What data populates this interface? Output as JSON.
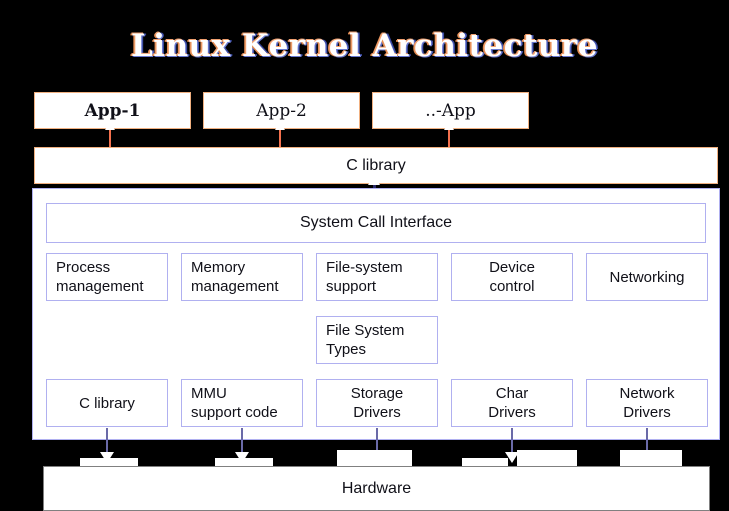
{
  "title": "Linux Kernel Architecture",
  "apps": [
    {
      "label": "App-1",
      "bold": true
    },
    {
      "label": "App-2",
      "bold": false
    },
    {
      "label": "..-App",
      "bold": false
    }
  ],
  "c_library_top": "C library",
  "kernel": {
    "system_call_interface": "System Call Interface",
    "subsystems": [
      "Process\nmanagement",
      "Memory\nmanagement",
      "File-system\nsupport",
      "Device\ncontrol",
      "Networking"
    ],
    "file_system_types": "File System\nTypes",
    "implementations": [
      "C library",
      "MMU\nsupport code",
      "Storage\nDrivers",
      "Char\nDrivers",
      "Network\nDrivers"
    ]
  },
  "hardware": "Hardware",
  "colors": {
    "background": "#000000",
    "app_border": "#f0b080",
    "kernel_border": "#b0b0f0",
    "hardware_border": "#808080",
    "app_arrow": "#f4714e",
    "hw_arrow": "#6a6aa8",
    "box_fill": "#ffffff",
    "text": "#101018"
  }
}
